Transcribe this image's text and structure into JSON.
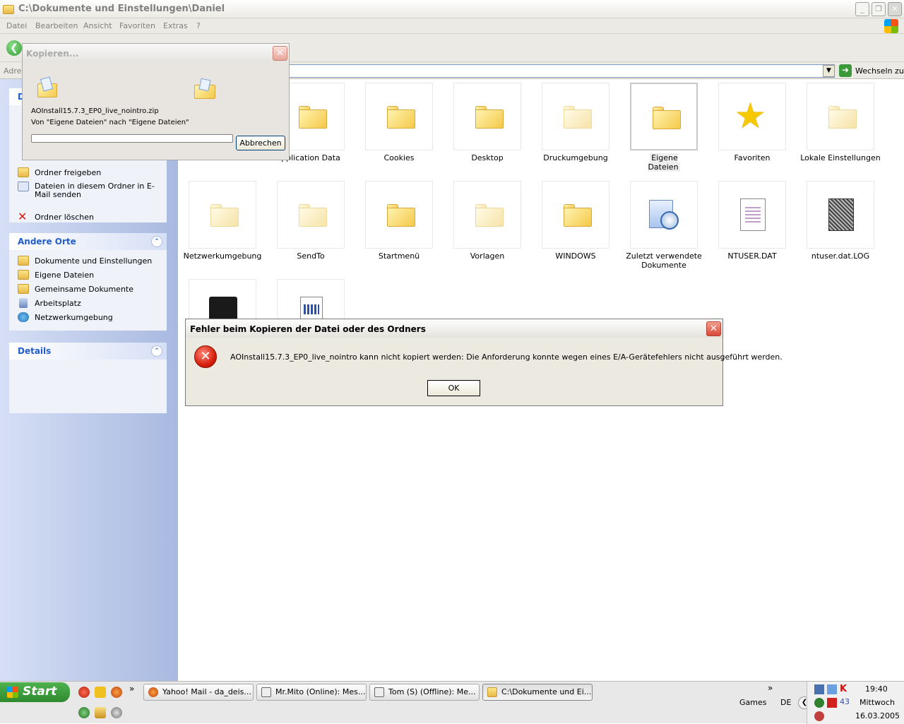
{
  "window": {
    "title": "C:\\Dokumente und Einstellungen\\Daniel"
  },
  "menu": [
    "Datei",
    "Bearbeiten",
    "Ansicht",
    "Favoriten",
    "Extras",
    "?"
  ],
  "address": {
    "label": "Adres",
    "go_label": "Wechseln zu"
  },
  "sidebar": {
    "tasks_header": "D",
    "tasks": [
      "Ordner freigeben",
      "Dateien in diesem Ordner in E-Mail senden",
      "Ordner löschen"
    ],
    "other_header": "Andere Orte",
    "other": [
      "Dokumente und Einstellungen",
      "Eigene Dateien",
      "Gemeinsame Dokumente",
      "Arbeitsplatz",
      "Netzwerkumgebung"
    ],
    "details_header": "Details"
  },
  "items": [
    {
      "label": "pplication Data",
      "icon": "folder"
    },
    {
      "label": "Cookies",
      "icon": "folder"
    },
    {
      "label": "Desktop",
      "icon": "folder"
    },
    {
      "label": "Druckumgebung",
      "icon": "folder-faded"
    },
    {
      "label": "Eigene Dateien",
      "icon": "folder",
      "selected": true
    },
    {
      "label": "Favoriten",
      "icon": "star"
    },
    {
      "label": "Lokale Einstellungen",
      "icon": "folder-faded"
    },
    {
      "label": "Netzwerkumgebung",
      "icon": "folder-faded"
    },
    {
      "label": "SendTo",
      "icon": "folder-faded"
    },
    {
      "label": "Startmenü",
      "icon": "folder"
    },
    {
      "label": "Vorlagen",
      "icon": "folder-faded"
    },
    {
      "label": "WINDOWS",
      "icon": "folder"
    },
    {
      "label": "Zuletzt verwendete Dokumente",
      "icon": "recent"
    },
    {
      "label": "NTUSER.DAT",
      "icon": "file-dat"
    },
    {
      "label": "ntuser.dat.LOG",
      "icon": "file-log"
    }
  ],
  "copy_dialog": {
    "title": "Kopieren...",
    "filename": "AOInstall15.7.3_EP0_live_nointro.zip",
    "from_to": "Von \"Eigene Dateien\" nach \"Eigene Dateien\"",
    "abort_label": "Abbrechen",
    "progress": 0
  },
  "error_dialog": {
    "title": "Fehler beim Kopieren der Datei oder des Ordners",
    "message": "AOInstall15.7.3_EP0_live_nointro kann nicht kopiert werden: Die Anforderung konnte wegen eines E/A-Gerätefehlers nicht ausgeführt werden.",
    "ok_label": "OK"
  },
  "taskbar": {
    "start_label": "Start",
    "chevron": "»",
    "tasks": [
      {
        "label": "Yahoo! Mail - da_deis...",
        "icon_color": "#e87a20"
      },
      {
        "label": "Mr.Mito (Online): Mes...",
        "icon_color": "#6b6b6b"
      },
      {
        "label": "Tom (S) (Offline): Me...",
        "icon_color": "#6b6b6b"
      },
      {
        "label": "C:\\Dokumente und Ei...",
        "icon_color": "#e8b848",
        "active": true
      }
    ],
    "games_label": "Games",
    "lang": "DE",
    "tray_count": "43",
    "time": "19:40",
    "weekday": "Mittwoch",
    "date": "16.03.2005"
  }
}
